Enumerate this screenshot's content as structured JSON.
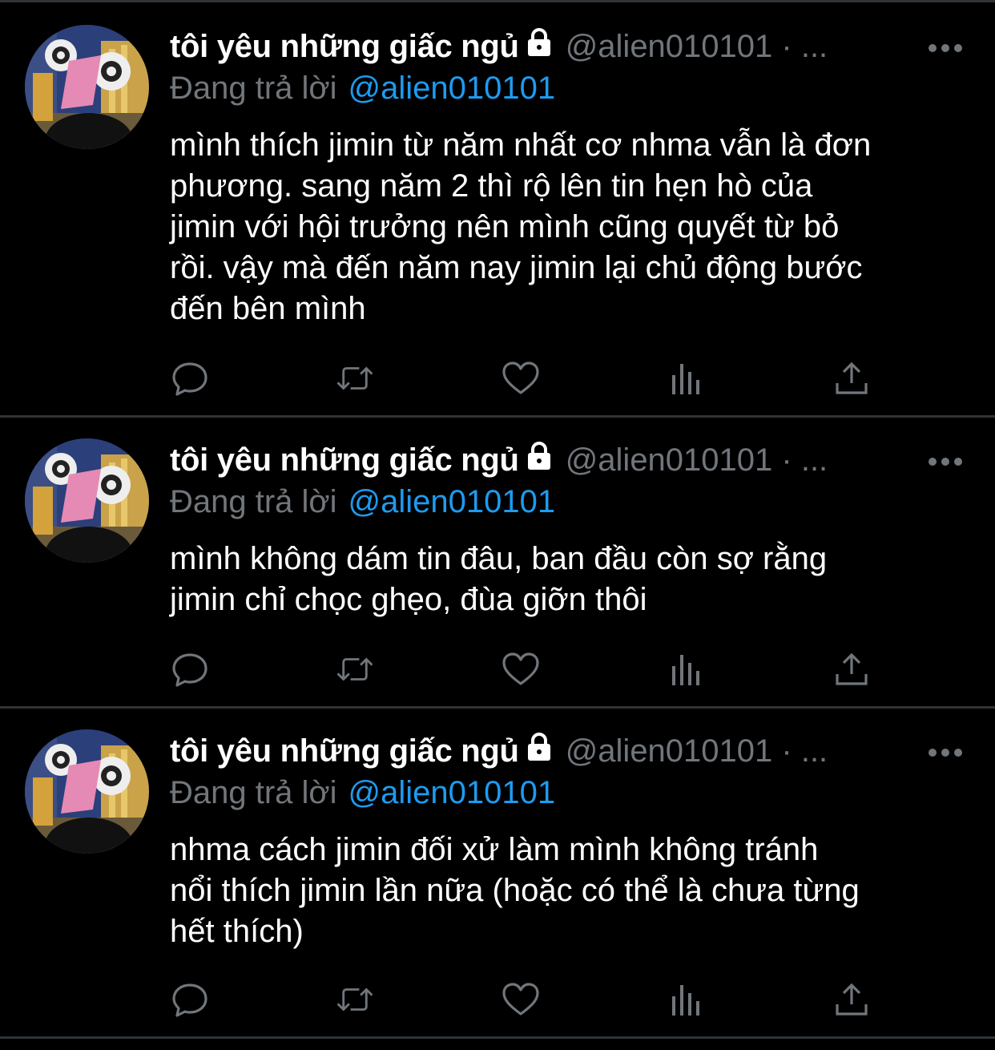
{
  "theme": {
    "background": "#000000",
    "text": "#ffffff",
    "muted": "#71767b",
    "accent": "#1d9bf0",
    "divider": "#2f3336"
  },
  "tweets": [
    {
      "display_name": "tôi yêu những giấc ngủ",
      "handle": "@alien010101 · ...",
      "reply_prefix": "Đang trả lời",
      "reply_target": "@alien010101",
      "text": "mình thích jimin từ năm nhất cơ nhma vẫn là đơn\nphương. sang năm 2 thì rộ lên tin hẹn hò của\njimin với hội trưởng nên mình cũng quyết từ bỏ\nrồi. vậy mà đến năm nay jimin lại chủ động bước\nđến bên mình",
      "icons": [
        "reply-icon",
        "retweet-icon",
        "like-icon",
        "analytics-icon",
        "share-icon"
      ]
    },
    {
      "display_name": "tôi yêu những giấc ngủ",
      "handle": "@alien010101 · ...",
      "reply_prefix": "Đang trả lời",
      "reply_target": "@alien010101",
      "text": "mình không dám tin đâu, ban đầu còn sợ rằng\njimin chỉ chọc ghẹo, đùa giỡn thôi",
      "icons": [
        "reply-icon",
        "retweet-icon",
        "like-icon",
        "analytics-icon",
        "share-icon"
      ]
    },
    {
      "display_name": "tôi yêu những giấc ngủ",
      "handle": "@alien010101 · ...",
      "reply_prefix": "Đang trả lời",
      "reply_target": "@alien010101",
      "text": "nhma cách jimin đối xử làm mình không tránh\nnổi thích jimin lần nữa (hoặc có thể là chưa từng\nhết thích)",
      "icons": [
        "reply-icon",
        "retweet-icon",
        "like-icon",
        "analytics-icon",
        "share-icon"
      ]
    }
  ]
}
